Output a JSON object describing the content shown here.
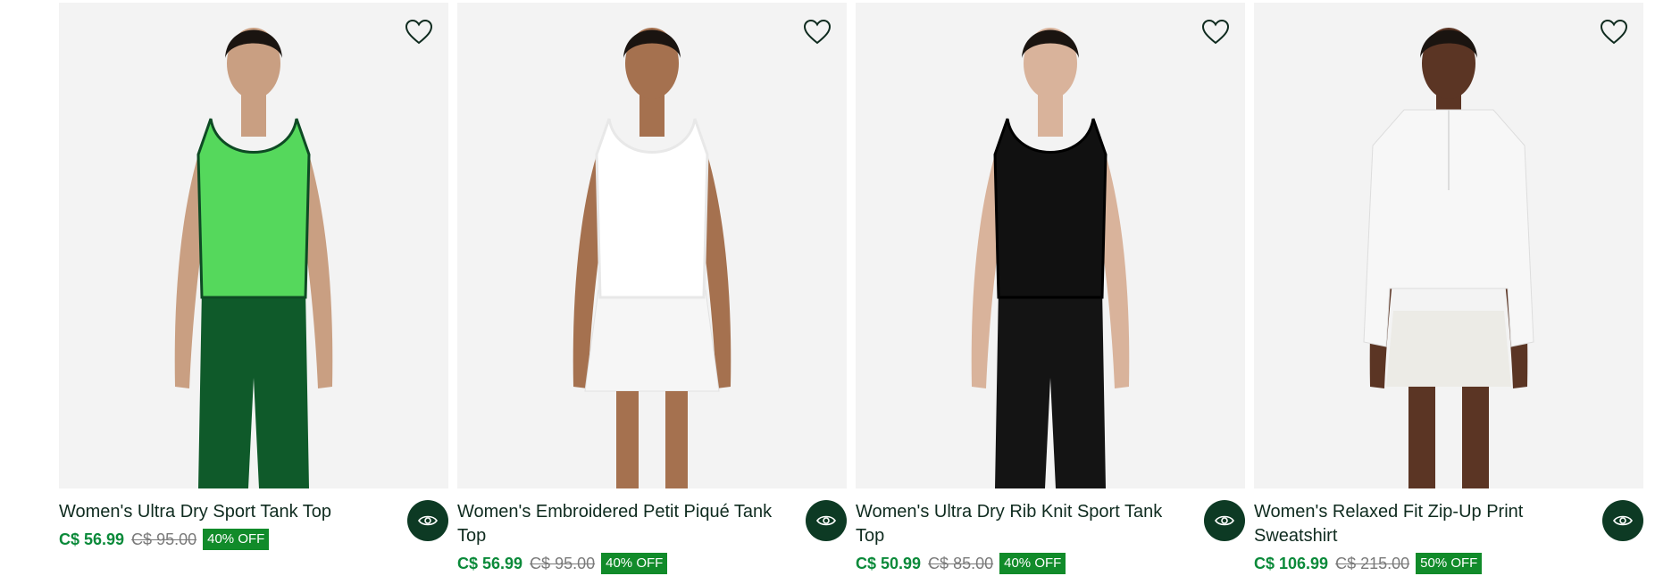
{
  "products": [
    {
      "title": "Women's Ultra Dry Sport Tank Top",
      "price": "C$ 56.99",
      "original_price": "C$ 95.00",
      "discount": "40% OFF",
      "top_color": "#55d85c",
      "trim_color": "#0e4a24",
      "bottom_color": "#0f5a2a",
      "bottom_type": "leggings",
      "skin": "#c99f82"
    },
    {
      "title": "Women's Embroidered Petit Piqué Tank Top",
      "price": "C$ 56.99",
      "original_price": "C$ 95.00",
      "discount": "40% OFF",
      "top_color": "#ffffff",
      "trim_color": "#e8e8e8",
      "bottom_color": "#f6f6f6",
      "bottom_type": "skirt",
      "skin": "#a5714f"
    },
    {
      "title": "Women's Ultra Dry Rib Knit Sport Tank Top",
      "price": "C$ 50.99",
      "original_price": "C$ 85.00",
      "discount": "40% OFF",
      "top_color": "#111111",
      "trim_color": "#000000",
      "bottom_color": "#141414",
      "bottom_type": "leggings",
      "skin": "#d9b39b"
    },
    {
      "title": "Women's Relaxed Fit Zip-Up Print Sweatshirt",
      "price": "C$ 106.99",
      "original_price": "C$ 215.00",
      "discount": "50% OFF",
      "top_color": "#f7f7f7",
      "trim_color": "#dddddd",
      "bottom_color": "#ecebe6",
      "bottom_type": "shorts",
      "skin": "#5b3524"
    }
  ],
  "icons": {
    "wishlist": "heart-outline-icon",
    "quick_view": "eye-icon"
  }
}
